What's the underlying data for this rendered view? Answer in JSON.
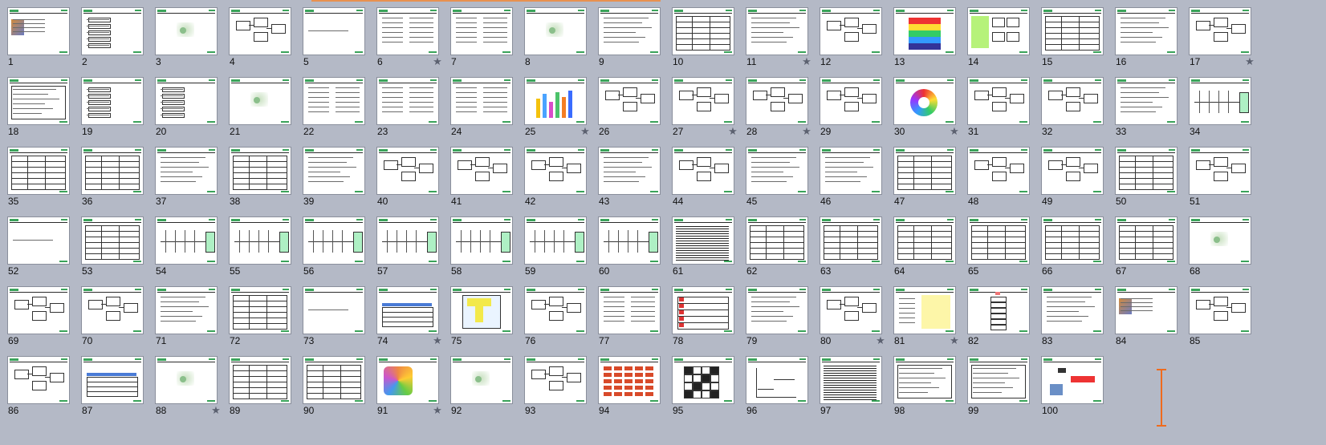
{
  "colors": {
    "background": "#b4b9c6",
    "accent_orange": "#ef6b1d",
    "logo_green": "#3aa35a"
  },
  "slide_sorter": {
    "slides": [
      {
        "number": "1",
        "star": false,
        "layout": "photo"
      },
      {
        "number": "2",
        "star": false,
        "layout": "list"
      },
      {
        "number": "3",
        "star": false,
        "layout": "image"
      },
      {
        "number": "4",
        "star": false,
        "layout": "diagram"
      },
      {
        "number": "5",
        "star": false,
        "layout": "title"
      },
      {
        "number": "6",
        "star": true,
        "layout": "text2col"
      },
      {
        "number": "7",
        "star": false,
        "layout": "text2col"
      },
      {
        "number": "8",
        "star": false,
        "layout": "image"
      },
      {
        "number": "9",
        "star": false,
        "layout": "text"
      },
      {
        "number": "10",
        "star": false,
        "layout": "table"
      },
      {
        "number": "11",
        "star": true,
        "layout": "text"
      },
      {
        "number": "12",
        "star": false,
        "layout": "diagram"
      },
      {
        "number": "13",
        "star": false,
        "layout": "pyramid"
      },
      {
        "number": "14",
        "star": false,
        "layout": "green"
      },
      {
        "number": "15",
        "star": false,
        "layout": "table"
      },
      {
        "number": "16",
        "star": false,
        "layout": "text"
      },
      {
        "number": "17",
        "star": true,
        "layout": "diagram"
      },
      {
        "number": "18",
        "star": false,
        "layout": "boxtext"
      },
      {
        "number": "19",
        "star": false,
        "layout": "list"
      },
      {
        "number": "20",
        "star": false,
        "layout": "list"
      },
      {
        "number": "21",
        "star": false,
        "layout": "image"
      },
      {
        "number": "22",
        "star": false,
        "layout": "text2col"
      },
      {
        "number": "23",
        "star": false,
        "layout": "text2col"
      },
      {
        "number": "24",
        "star": false,
        "layout": "text2col"
      },
      {
        "number": "25",
        "star": true,
        "layout": "bars"
      },
      {
        "number": "26",
        "star": false,
        "layout": "diagram"
      },
      {
        "number": "27",
        "star": true,
        "layout": "diagram"
      },
      {
        "number": "28",
        "star": true,
        "layout": "diagram"
      },
      {
        "number": "29",
        "star": false,
        "layout": "diagram"
      },
      {
        "number": "30",
        "star": true,
        "layout": "circle"
      },
      {
        "number": "31",
        "star": false,
        "layout": "diagram"
      },
      {
        "number": "32",
        "star": false,
        "layout": "diagram"
      },
      {
        "number": "33",
        "star": false,
        "layout": "text"
      },
      {
        "number": "34",
        "star": false,
        "layout": "fishbone"
      },
      {
        "number": "35",
        "star": false,
        "layout": "table"
      },
      {
        "number": "36",
        "star": false,
        "layout": "table"
      },
      {
        "number": "37",
        "star": false,
        "layout": "text"
      },
      {
        "number": "38",
        "star": false,
        "layout": "table"
      },
      {
        "number": "39",
        "star": false,
        "layout": "text"
      },
      {
        "number": "40",
        "star": false,
        "layout": "diagram"
      },
      {
        "number": "41",
        "star": false,
        "layout": "diagram"
      },
      {
        "number": "42",
        "star": false,
        "layout": "diagram"
      },
      {
        "number": "43",
        "star": false,
        "layout": "text"
      },
      {
        "number": "44",
        "star": false,
        "layout": "diagram"
      },
      {
        "number": "45",
        "star": false,
        "layout": "text"
      },
      {
        "number": "46",
        "star": false,
        "layout": "text"
      },
      {
        "number": "47",
        "star": false,
        "layout": "table"
      },
      {
        "number": "48",
        "star": false,
        "layout": "diagram"
      },
      {
        "number": "49",
        "star": false,
        "layout": "diagram"
      },
      {
        "number": "50",
        "star": false,
        "layout": "table"
      },
      {
        "number": "51",
        "star": false,
        "layout": "diagram"
      },
      {
        "number": "52",
        "star": false,
        "layout": "title"
      },
      {
        "number": "53",
        "star": false,
        "layout": "table"
      },
      {
        "number": "54",
        "star": false,
        "layout": "fishbone"
      },
      {
        "number": "55",
        "star": false,
        "layout": "fishbone"
      },
      {
        "number": "56",
        "star": false,
        "layout": "fishbone"
      },
      {
        "number": "57",
        "star": false,
        "layout": "fishbone"
      },
      {
        "number": "58",
        "star": false,
        "layout": "fishbone"
      },
      {
        "number": "59",
        "star": false,
        "layout": "fishbone"
      },
      {
        "number": "60",
        "star": false,
        "layout": "fishbone"
      },
      {
        "number": "61",
        "star": false,
        "layout": "dense"
      },
      {
        "number": "62",
        "star": false,
        "layout": "table"
      },
      {
        "number": "63",
        "star": false,
        "layout": "table"
      },
      {
        "number": "64",
        "star": false,
        "layout": "table"
      },
      {
        "number": "65",
        "star": false,
        "layout": "table"
      },
      {
        "number": "66",
        "star": false,
        "layout": "table"
      },
      {
        "number": "67",
        "star": false,
        "layout": "table"
      },
      {
        "number": "68",
        "star": false,
        "layout": "image"
      },
      {
        "number": "69",
        "star": false,
        "layout": "diagram"
      },
      {
        "number": "70",
        "star": false,
        "layout": "diagram"
      },
      {
        "number": "71",
        "star": false,
        "layout": "text"
      },
      {
        "number": "72",
        "star": false,
        "layout": "table"
      },
      {
        "number": "73",
        "star": false,
        "layout": "title"
      },
      {
        "number": "74",
        "star": true,
        "layout": "bluetable"
      },
      {
        "number": "75",
        "star": false,
        "layout": "yellow"
      },
      {
        "number": "76",
        "star": false,
        "layout": "diagram"
      },
      {
        "number": "77",
        "star": false,
        "layout": "text2col"
      },
      {
        "number": "78",
        "star": false,
        "layout": "redtable"
      },
      {
        "number": "79",
        "star": false,
        "layout": "text"
      },
      {
        "number": "80",
        "star": true,
        "layout": "diagram"
      },
      {
        "number": "81",
        "star": true,
        "layout": "yellowbox"
      },
      {
        "number": "82",
        "star": false,
        "layout": "flow"
      },
      {
        "number": "83",
        "star": false,
        "layout": "text"
      },
      {
        "number": "84",
        "star": false,
        "layout": "photo"
      },
      {
        "number": "85",
        "star": false,
        "layout": "diagram"
      },
      {
        "number": "86",
        "star": false,
        "layout": "diagram"
      },
      {
        "number": "87",
        "star": false,
        "layout": "bluetable"
      },
      {
        "number": "88",
        "star": true,
        "layout": "image"
      },
      {
        "number": "89",
        "star": false,
        "layout": "table"
      },
      {
        "number": "90",
        "star": false,
        "layout": "table"
      },
      {
        "number": "91",
        "star": true,
        "layout": "colorful"
      },
      {
        "number": "92",
        "star": false,
        "layout": "image"
      },
      {
        "number": "93",
        "star": false,
        "layout": "diagram"
      },
      {
        "number": "94",
        "star": false,
        "layout": "redgrid"
      },
      {
        "number": "95",
        "star": false,
        "layout": "grid"
      },
      {
        "number": "96",
        "star": false,
        "layout": "chart"
      },
      {
        "number": "97",
        "star": false,
        "layout": "dense"
      },
      {
        "number": "98",
        "star": false,
        "layout": "boxtext"
      },
      {
        "number": "99",
        "star": false,
        "layout": "boxtext"
      },
      {
        "number": "100",
        "star": false,
        "layout": "final"
      }
    ]
  },
  "icons": {
    "star": "★",
    "star_name": "slide-transition-star-icon"
  }
}
